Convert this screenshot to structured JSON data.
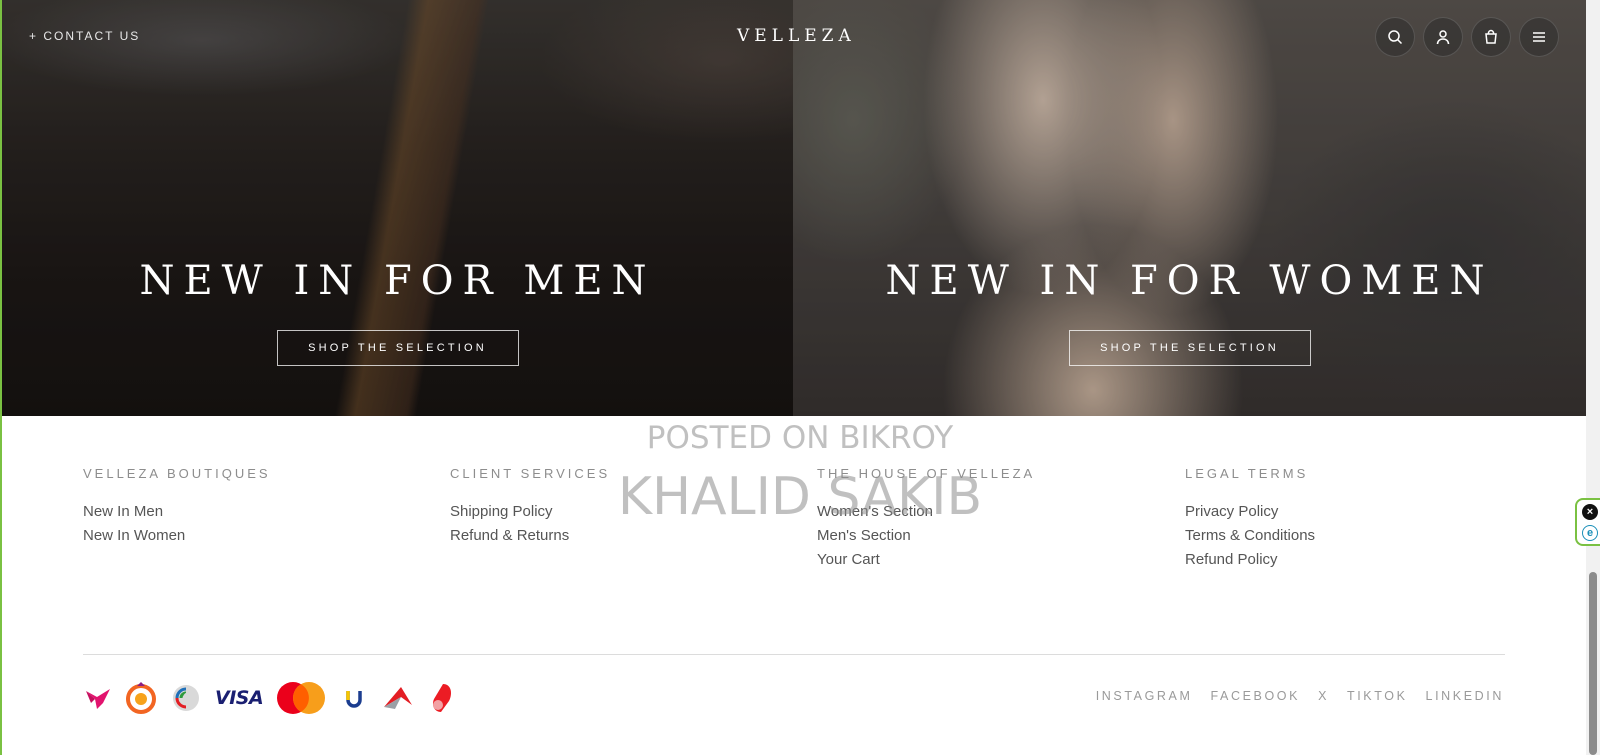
{
  "header": {
    "contact_label": "+ CONTACT US",
    "logo": "VELLEZA",
    "icons": [
      "search-icon",
      "account-icon",
      "cart-icon",
      "menu-icon"
    ]
  },
  "hero": {
    "men": {
      "title": "NEW IN FOR MEN",
      "button": "SHOP THE SELECTION"
    },
    "women": {
      "title": "NEW IN FOR WOMEN",
      "button": "SHOP THE SELECTION"
    }
  },
  "watermark": {
    "line1": "POSTED ON BIKROY",
    "line2": "KHALID SAKIB"
  },
  "footer": {
    "columns": [
      {
        "title": "VELLEZA BOUTIQUES",
        "links": [
          "New In Men",
          "New In Women"
        ]
      },
      {
        "title": "CLIENT SERVICES",
        "links": [
          "Shipping Policy",
          "Refund & Returns"
        ]
      },
      {
        "title": "THE HOUSE OF VELLEZA",
        "links": [
          "Women's Section",
          "Men's Section",
          "Your Cart"
        ]
      },
      {
        "title": "LEGAL TERMS",
        "links": [
          "Privacy Policy",
          "Terms & Conditions",
          "Refund Policy"
        ]
      }
    ],
    "payments": [
      "bkash-icon",
      "rocket-icon",
      "dbbl-nexus-icon",
      "VISA",
      "mastercard-icon",
      "upay-icon",
      "tap-icon",
      "nagad-icon"
    ],
    "social": [
      "INSTAGRAM",
      "FACEBOOK",
      "X",
      "TIKTOK",
      "LINKEDIN"
    ]
  },
  "colors": {
    "accent_border": "#7ac142",
    "footer_title": "#8d8d8d",
    "footer_link": "#555555"
  }
}
